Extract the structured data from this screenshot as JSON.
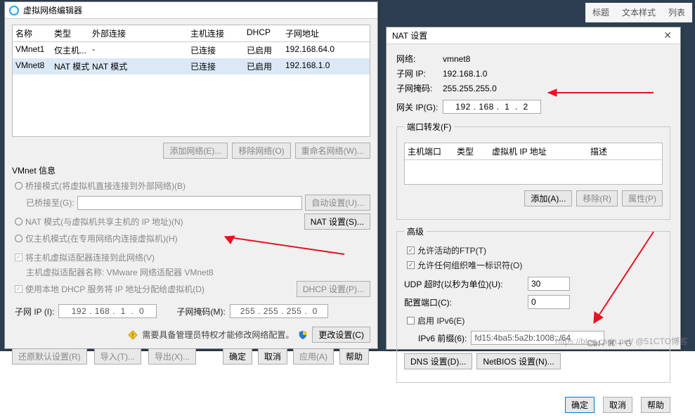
{
  "bgbar": {
    "items": [
      "标题",
      "文本样式",
      "列表"
    ]
  },
  "vneditor": {
    "title": "虚拟网络编辑器",
    "cols": {
      "name": "名称",
      "type": "类型",
      "ext": "外部连接",
      "host": "主机连接",
      "dhcp": "DHCP",
      "sub": "子网地址"
    },
    "rows": [
      {
        "name": "VMnet1",
        "type": "仅主机...",
        "ext": "-",
        "host": "已连接",
        "dhcp": "已启用",
        "sub": "192.168.64.0"
      },
      {
        "name": "VMnet8",
        "type": "NAT 模式",
        "ext": "NAT 模式",
        "host": "已连接",
        "dhcp": "已启用",
        "sub": "192.168.1.0"
      }
    ],
    "btns": {
      "add": "添加网络(E)...",
      "remove": "移除网络(O)",
      "rename": "重命名网络(W)..."
    },
    "info_title": "VMnet 信息",
    "radio_bridge": "桥接模式(将虚拟机直接连接到外部网络)(B)",
    "bridge_to": "已桥接至(G):",
    "auto_btn": "自动设置(U)...",
    "radio_nat": "NAT 模式(与虚拟机共享主机的 IP 地址)(N)",
    "nat_btn": "NAT 设置(S)...",
    "radio_host": "仅主机模式(在专用网络内连接虚拟机)(H)",
    "chk_connect": "将主机虚拟适配器连接到此网络(V)",
    "adapter_line": "主机虚拟适配器名称: VMware 网络适配器 VMnet8",
    "chk_dhcp": "使用本地 DHCP 服务将 IP 地址分配给虚拟机(D)",
    "dhcp_btn": "DHCP 设置(P)...",
    "subnet_ip_lbl": "子网 IP (I):",
    "subnet_ip": "192 . 168 .  1  .  0",
    "subnet_mask_lbl": "子网掩码(M):",
    "subnet_mask": "255 . 255 . 255 .  0",
    "warn_text": "需要具备管理员特权才能修改网络配置。",
    "change_btn": "更改设置(C)",
    "bottom": {
      "restore": "还原默认设置(R)",
      "import": "导入(T)...",
      "export": "导出(X)...",
      "ok": "确定",
      "cancel": "取消",
      "apply": "应用(A)",
      "help": "帮助"
    }
  },
  "nat": {
    "title": "NAT 设置",
    "net_lbl": "网络:",
    "net": "vmnet8",
    "subip_lbl": "子网 IP:",
    "subip": "192.168.1.0",
    "mask_lbl": "子网掩码:",
    "mask": "255.255.255.0",
    "gw_lbl": "网关 IP(G):",
    "gw": "192 . 168 .  1  .  2",
    "pf_title": "端口转发(F)",
    "pf_cols": {
      "host": "主机端口",
      "type": "类型",
      "ip": "虚拟机 IP 地址",
      "desc": "描述"
    },
    "pf_btns": {
      "add": "添加(A)...",
      "remove": "移除(R)",
      "props": "属性(P)"
    },
    "adv_title": "高级",
    "chk_activeftp": "允许活动的FTP(T)",
    "chk_anyoui": "允许任何组织唯一标识符(O)",
    "udp_lbl": "UDP 超时(以秒为单位)(U):",
    "udp": "30",
    "cfgport_lbl": "配置端口(C):",
    "cfgport": "0",
    "chk_ipv6": "启用 IPv6(E)",
    "ipv6_lbl": "IPv6 前缀(6):",
    "ipv6": "fd15:4ba5:5a2b:1008::/64",
    "dns_btn": "DNS 设置(D)...",
    "netbios_btn": "NetBIOS 设置(N)...",
    "ok": "确定",
    "cancel": "取消",
    "help": "帮助"
  },
  "watermark": "https://blog.csdn.net/   @51CTO博客",
  "shortcut": "Ctrl / ⌘ + G"
}
